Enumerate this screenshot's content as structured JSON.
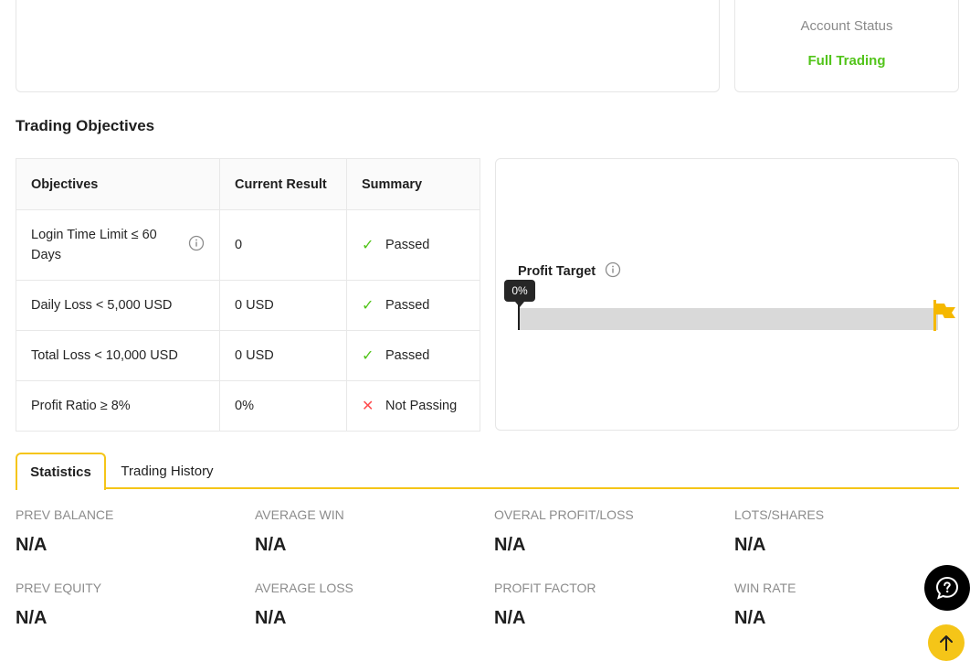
{
  "account": {
    "status_label": "Account Status",
    "status_value": "Full Trading",
    "status_color": "#52c41a"
  },
  "objectives_section": {
    "title": "Trading Objectives",
    "headers": [
      "Objectives",
      "Current Result",
      "Summary"
    ],
    "rows": [
      {
        "objective": "Login Time Limit ≤ 60 Days",
        "current": "0",
        "summary": "Passed",
        "status": "passed",
        "has_info": true
      },
      {
        "objective": "Daily Loss < 5,000 USD",
        "current": "0 USD",
        "summary": "Passed",
        "status": "passed"
      },
      {
        "objective": "Total Loss < 10,000 USD",
        "current": "0 USD",
        "summary": "Passed",
        "status": "passed"
      },
      {
        "objective": "Profit Ratio ≥ 8%",
        "current": "0%",
        "summary": "Not Passing",
        "status": "failed"
      }
    ]
  },
  "profit_target": {
    "title": "Profit Target",
    "progress_label": "0%",
    "progress_fraction": 0,
    "accent_color": "#f5b800"
  },
  "tabs": [
    {
      "label": "Statistics",
      "active": true
    },
    {
      "label": "Trading History",
      "active": false
    }
  ],
  "statistics": [
    {
      "label": "PREV BALANCE",
      "value": "N/A"
    },
    {
      "label": "AVERAGE WIN",
      "value": "N/A"
    },
    {
      "label": "OVERAL PROFIT/LOSS",
      "value": "N/A"
    },
    {
      "label": "LOTS/SHARES",
      "value": "N/A"
    },
    {
      "label": "PREV EQUITY",
      "value": "N/A"
    },
    {
      "label": "AVERAGE LOSS",
      "value": "N/A"
    },
    {
      "label": "PROFIT FACTOR",
      "value": "N/A"
    },
    {
      "label": "WIN RATE",
      "value": "N/A"
    }
  ],
  "floating": {
    "help_icon": "chat-help-icon",
    "scroll_top_icon": "arrow-up-icon"
  },
  "colors": {
    "tab_accent": "#f5c518",
    "passed": "#52c41a",
    "failed": "#ff4d4f"
  }
}
